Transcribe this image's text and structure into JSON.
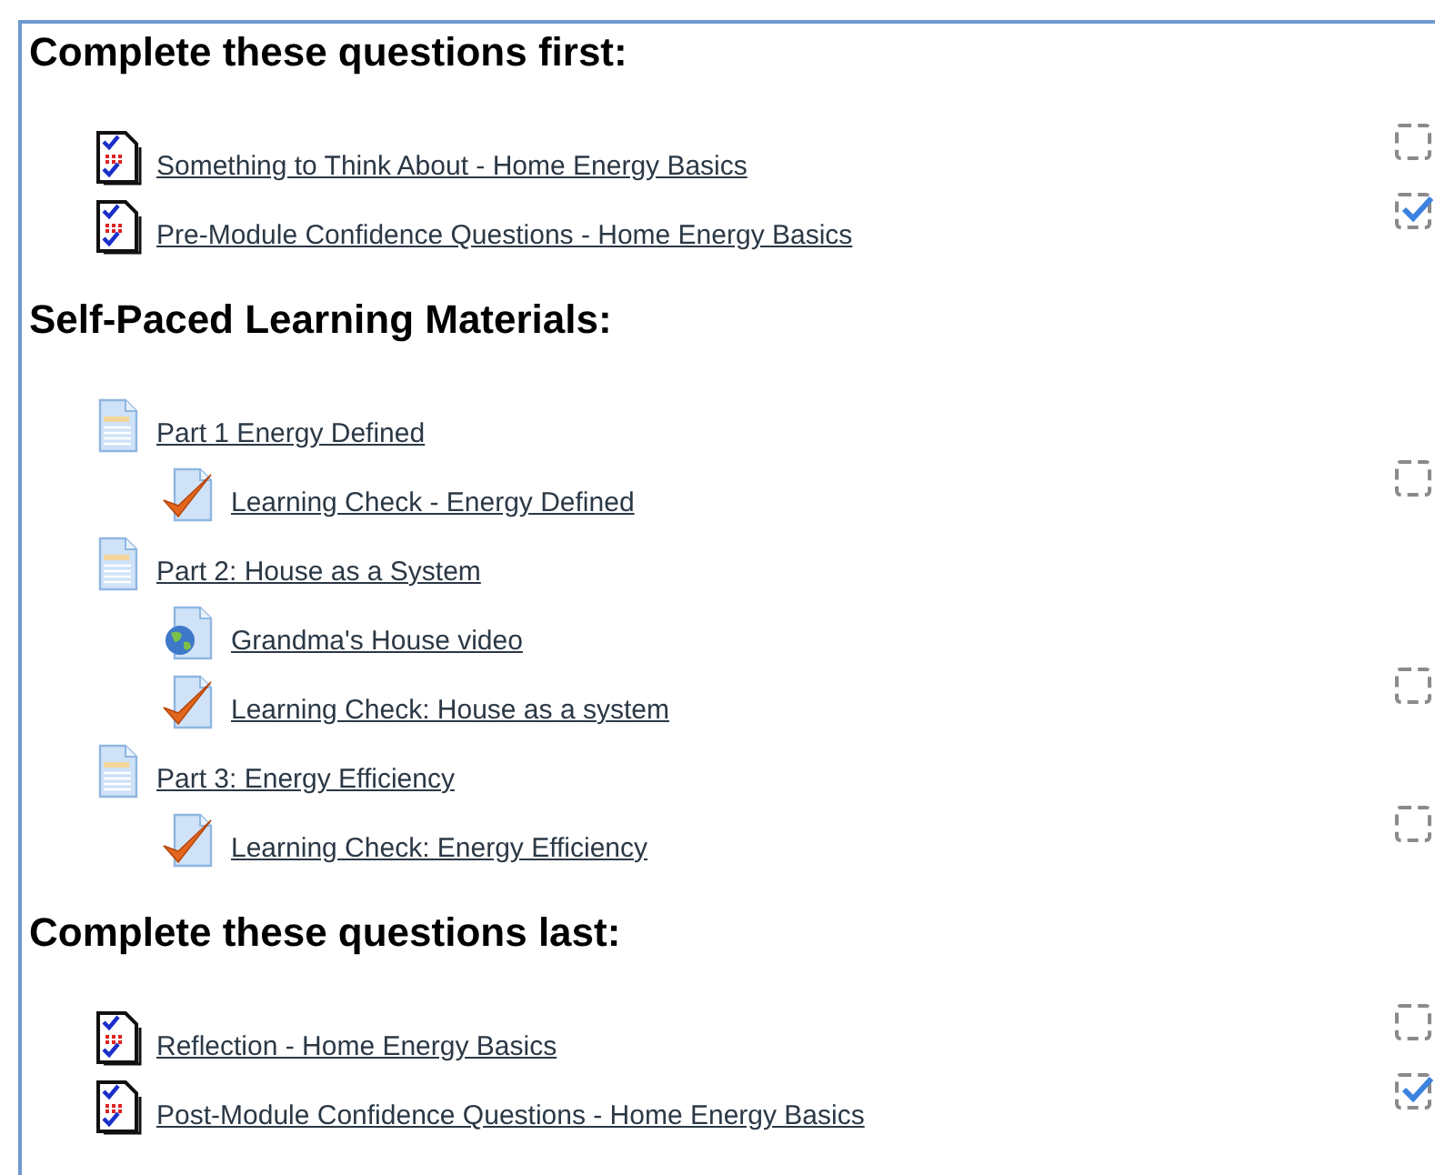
{
  "sections": [
    {
      "heading": "Complete these questions first:",
      "items": [
        {
          "kind": "quiz",
          "label": "Something to Think About - Home Energy Basics",
          "checked": false
        },
        {
          "kind": "quiz",
          "label": "Pre-Module Confidence Questions - Home Energy Basics",
          "checked": true
        }
      ]
    },
    {
      "heading": "Self-Paced Learning Materials:",
      "items": [
        {
          "kind": "page",
          "label": "Part 1 Energy Defined",
          "children": [
            {
              "kind": "check",
              "label": "Learning Check - Energy Defined",
              "checked": false
            }
          ]
        },
        {
          "kind": "page",
          "label": "Part 2: House as a System",
          "children": [
            {
              "kind": "video",
              "label": "Grandma's House video"
            },
            {
              "kind": "check",
              "label": "Learning Check: House as a system",
              "checked": false
            }
          ]
        },
        {
          "kind": "page",
          "label": "Part 3: Energy Efficiency",
          "children": [
            {
              "kind": "check",
              "label": "Learning Check: Energy Efficiency",
              "checked": false
            }
          ]
        }
      ]
    },
    {
      "heading": "Complete these questions last:",
      "items": [
        {
          "kind": "quiz",
          "label": "Reflection - Home Energy Basics",
          "checked": false
        },
        {
          "kind": "quiz",
          "label": "Post-Module Confidence Questions - Home Energy Basics",
          "checked": true
        }
      ]
    }
  ]
}
